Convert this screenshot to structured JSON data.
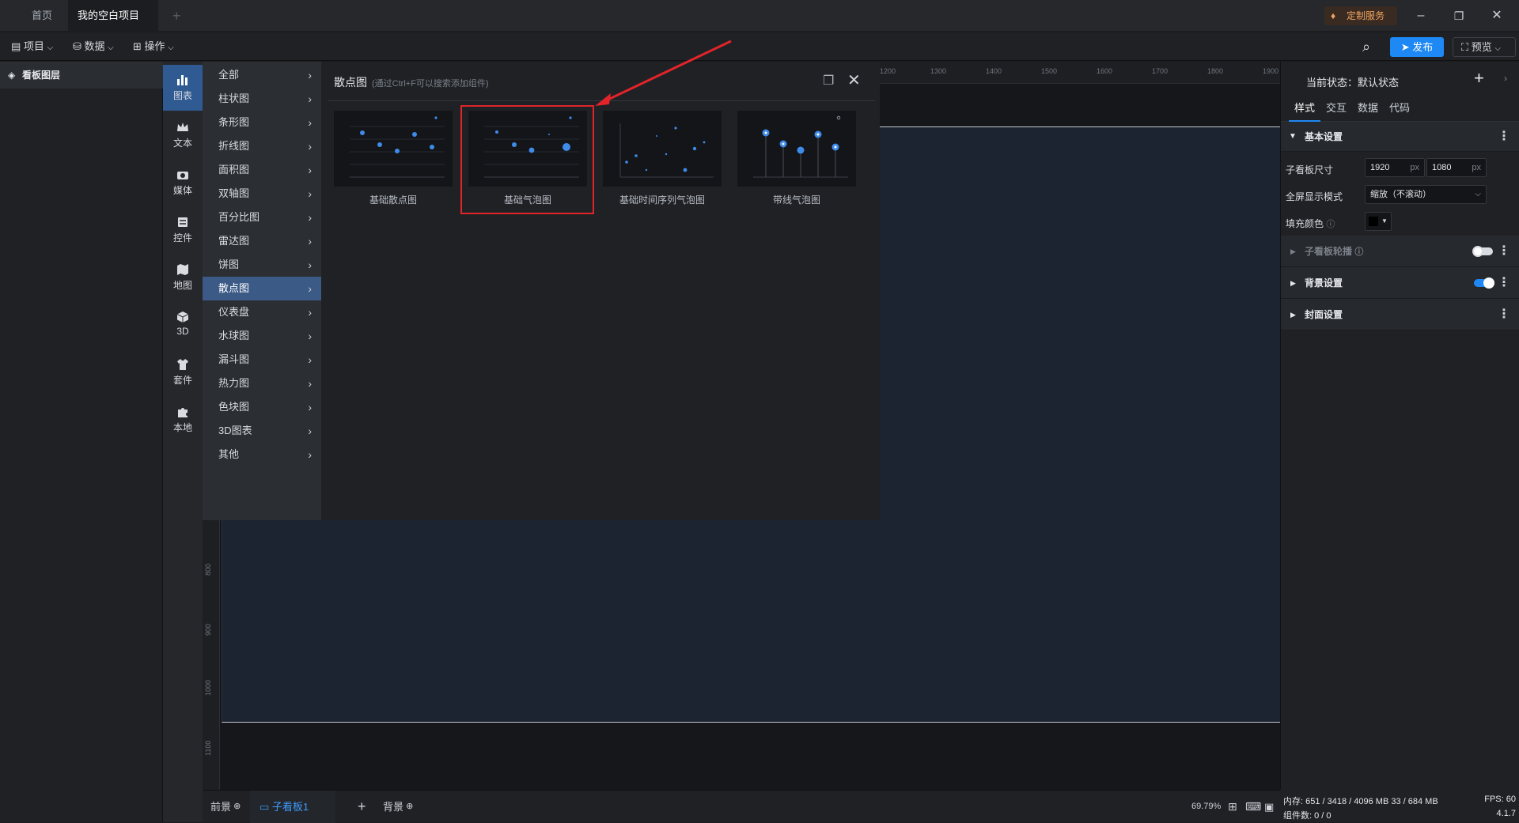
{
  "titlebar": {
    "tabs": [
      {
        "label": "首页"
      },
      {
        "label": "我的空白项目"
      }
    ],
    "add_tab": "+",
    "custom_service": "定制服务"
  },
  "toolbar": {
    "project": "项目",
    "data": "数据",
    "operate": "操作",
    "publish": "发布",
    "preview": "预览"
  },
  "layers": {
    "title": "看板图层"
  },
  "iconbar": [
    {
      "label": "图表",
      "icon": "bar-chart-icon"
    },
    {
      "label": "文本",
      "icon": "crown-icon"
    },
    {
      "label": "媒体",
      "icon": "camera-icon"
    },
    {
      "label": "控件",
      "icon": "widget-icon"
    },
    {
      "label": "地图",
      "icon": "map-icon"
    },
    {
      "label": "3D",
      "icon": "cube-icon"
    },
    {
      "label": "套件",
      "icon": "shirt-icon"
    },
    {
      "label": "本地",
      "icon": "puzzle-icon"
    }
  ],
  "categories": [
    "全部",
    "柱状图",
    "条形图",
    "折线图",
    "面积图",
    "双轴图",
    "百分比图",
    "雷达图",
    "饼图",
    "散点图",
    "仪表盘",
    "水球图",
    "漏斗图",
    "热力图",
    "色块图",
    "3D图表",
    "其他"
  ],
  "active_category": "散点图",
  "panel": {
    "title": "散点图",
    "hint": "(通过Ctrl+F可以搜索添加组件)",
    "cards": [
      {
        "label": "基础散点图"
      },
      {
        "label": "基础气泡图"
      },
      {
        "label": "基础时间序列气泡图"
      },
      {
        "label": "带线气泡图"
      }
    ]
  },
  "ruler_top": [
    "1200",
    "1300",
    "1400",
    "1500",
    "1600",
    "1700",
    "1800",
    "1900"
  ],
  "ruler_left": [
    "800",
    "900",
    "1000",
    "1100"
  ],
  "bottom": {
    "foreground": "前景",
    "board": "子看板1",
    "add": "+",
    "background": "背景",
    "zoom": "69.79%"
  },
  "right": {
    "state_label": "当前状态：默认状态",
    "tabs": [
      "样式",
      "交互",
      "数据",
      "代码"
    ],
    "basic": "基本设置",
    "size_label": "子看板尺寸",
    "width": "1920",
    "height": "1080",
    "unit": "px",
    "fullscreen_label": "全屏显示模式",
    "fullscreen_value": "缩放（不滚动）",
    "fill_label": "填充颜色",
    "carousel": "子看板轮播",
    "background_settings": "背景设置",
    "cover_settings": "封面设置"
  },
  "status": {
    "memory": "内存:  651 / 3418 / 4096 MB  33 / 684 MB",
    "fps": "FPS:  60",
    "components": "组件数: 0 / 0",
    "version": "4.1.7"
  },
  "colors": {
    "accent": "#1e88f5",
    "highlight": "#e0242a",
    "active_category": "#3b5a86",
    "active_icon": "#2f5a92",
    "chart_point": "#3f8bea"
  }
}
